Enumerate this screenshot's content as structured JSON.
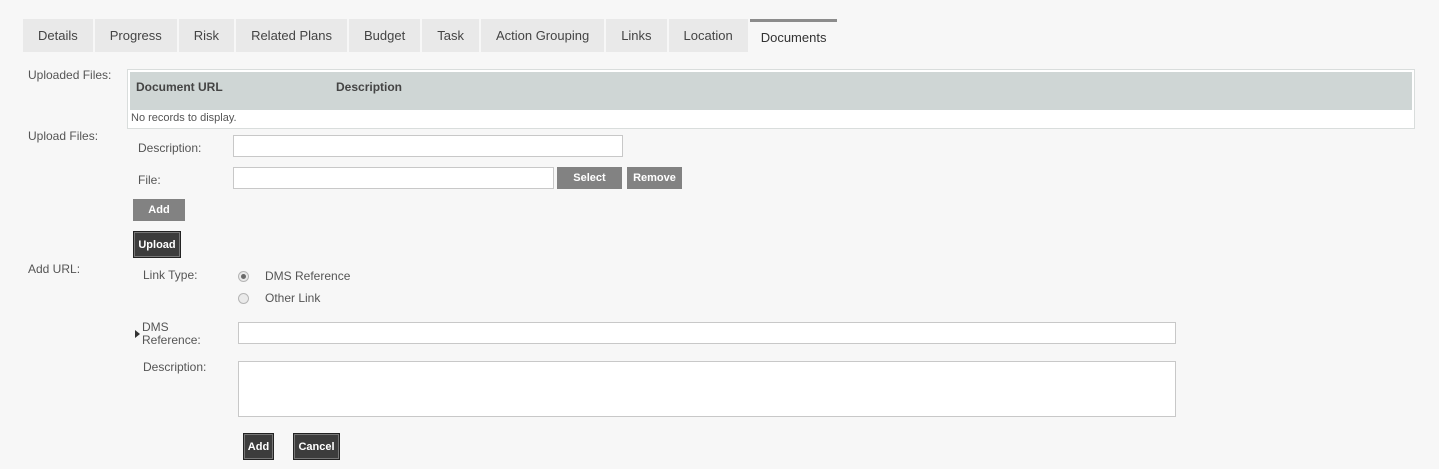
{
  "tabs": [
    {
      "label": "Details"
    },
    {
      "label": "Progress"
    },
    {
      "label": "Risk"
    },
    {
      "label": "Related Plans"
    },
    {
      "label": "Budget"
    },
    {
      "label": "Task"
    },
    {
      "label": "Action Grouping"
    },
    {
      "label": "Links"
    },
    {
      "label": "Location"
    },
    {
      "label": "Documents",
      "active": true
    }
  ],
  "uploaded": {
    "label": "Uploaded Files:",
    "columns": [
      "Document URL",
      "Description"
    ],
    "empty_text": "No records to display."
  },
  "upload": {
    "label": "Upload Files:",
    "description_label": "Description:",
    "description_value": "",
    "file_label": "File:",
    "file_value": "",
    "select_label": "Select",
    "remove_label": "Remove",
    "add_label": "Add",
    "upload_label": "Upload"
  },
  "add_url": {
    "label": "Add URL:",
    "link_type_label": "Link Type:",
    "options": [
      {
        "label": "DMS Reference",
        "checked": true
      },
      {
        "label": "Other Link",
        "checked": false
      }
    ],
    "dms_label_line1": "DMS",
    "dms_label_line2": "Reference:",
    "dms_value": "",
    "description_label": "Description:",
    "description_value": "",
    "add_label": "Add",
    "cancel_label": "Cancel"
  }
}
